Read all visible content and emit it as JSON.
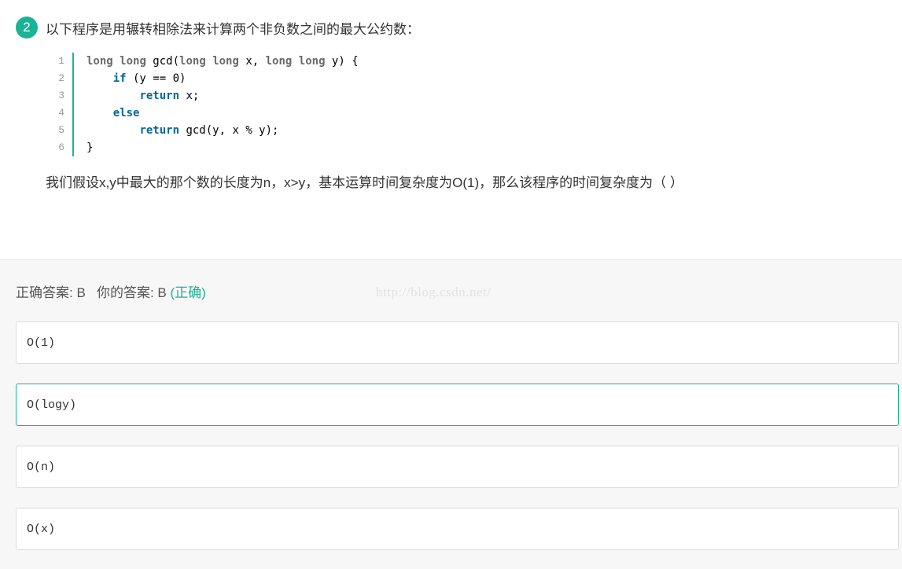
{
  "question": {
    "number": "2",
    "title": "以下程序是用辗转相除法来计算两个非负数之间的最大公约数：",
    "line_numbers": [
      "1",
      "2",
      "3",
      "4",
      "5",
      "6"
    ],
    "code": {
      "l1": {
        "kw1": "long",
        "kw2": "long",
        "t1": " gcd(",
        "kw3": "long",
        "kw4": "long",
        "t2": " x, ",
        "kw5": "long",
        "kw6": "long",
        "t3": " y) {"
      },
      "l2": {
        "kw": "if",
        "t": " (y == 0)"
      },
      "l3": {
        "kw": "return",
        "t": " x;"
      },
      "l4": {
        "kw": "else"
      },
      "l5": {
        "kw": "return",
        "t": " gcd(y, x % y);"
      },
      "l6": {
        "t": "}"
      }
    },
    "description": "我们假设x,y中最大的那个数的长度为n，x>y，基本运算时间复杂度为O(1)，那么该程序的时间复杂度为（   ）"
  },
  "result": {
    "correct_label": "正确答案: ",
    "correct_value": "B",
    "your_label": "你的答案: ",
    "your_value": "B",
    "status": "(正确)"
  },
  "watermark": "http://blog.csdn.net/",
  "options": [
    {
      "text": "O(1)"
    },
    {
      "text": "O(logy)"
    },
    {
      "text": "O(n)"
    },
    {
      "text": "O(x)"
    }
  ],
  "colors": {
    "accent": "#1ab394",
    "code_keyword_blue": "#006699",
    "code_keyword_gray": "#6a6a6a"
  }
}
